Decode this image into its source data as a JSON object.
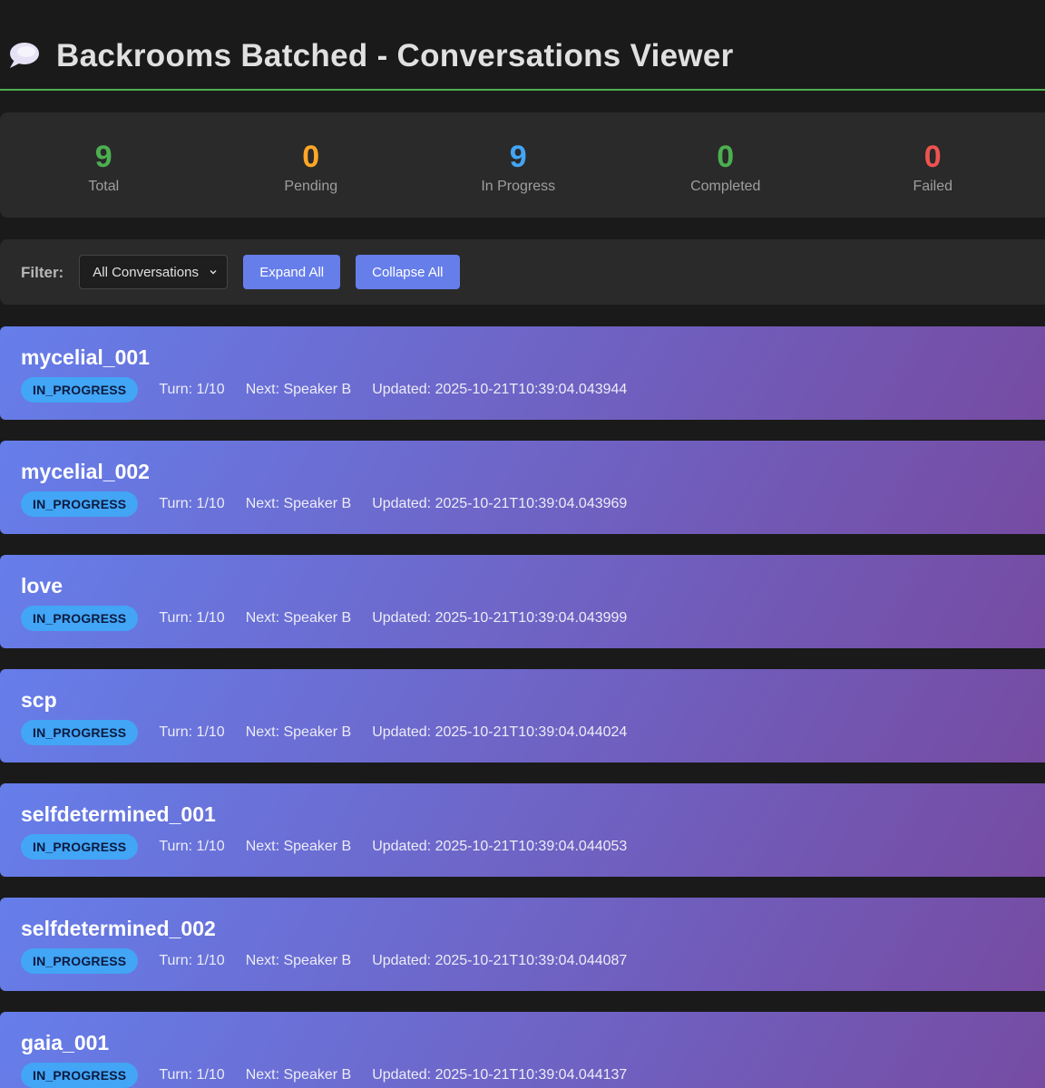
{
  "header": {
    "title": "Backrooms Batched - Conversations Viewer",
    "icon": "speech-bubble-icon"
  },
  "stats": [
    {
      "value": "9",
      "label": "Total",
      "color": "#4caf50"
    },
    {
      "value": "0",
      "label": "Pending",
      "color": "#ffa726"
    },
    {
      "value": "9",
      "label": "In Progress",
      "color": "#42a5f5"
    },
    {
      "value": "0",
      "label": "Completed",
      "color": "#4caf50"
    },
    {
      "value": "0",
      "label": "Failed",
      "color": "#ef5350"
    }
  ],
  "controls": {
    "filter_label": "Filter:",
    "filter_selected": "All Conversations",
    "expand_label": "Expand All",
    "collapse_label": "Collapse All"
  },
  "conversations": [
    {
      "name": "mycelial_001",
      "status": "IN_PROGRESS",
      "turn": "Turn: 1/10",
      "next": "Next: Speaker B",
      "updated": "Updated: 2025-10-21T10:39:04.043944"
    },
    {
      "name": "mycelial_002",
      "status": "IN_PROGRESS",
      "turn": "Turn: 1/10",
      "next": "Next: Speaker B",
      "updated": "Updated: 2025-10-21T10:39:04.043969"
    },
    {
      "name": "love",
      "status": "IN_PROGRESS",
      "turn": "Turn: 1/10",
      "next": "Next: Speaker B",
      "updated": "Updated: 2025-10-21T10:39:04.043999"
    },
    {
      "name": "scp",
      "status": "IN_PROGRESS",
      "turn": "Turn: 1/10",
      "next": "Next: Speaker B",
      "updated": "Updated: 2025-10-21T10:39:04.044024"
    },
    {
      "name": "selfdetermined_001",
      "status": "IN_PROGRESS",
      "turn": "Turn: 1/10",
      "next": "Next: Speaker B",
      "updated": "Updated: 2025-10-21T10:39:04.044053"
    },
    {
      "name": "selfdetermined_002",
      "status": "IN_PROGRESS",
      "turn": "Turn: 1/10",
      "next": "Next: Speaker B",
      "updated": "Updated: 2025-10-21T10:39:04.044087"
    },
    {
      "name": "gaia_001",
      "status": "IN_PROGRESS",
      "turn": "Turn: 1/10",
      "next": "Next: Speaker B",
      "updated": "Updated: 2025-10-21T10:39:04.044137"
    }
  ]
}
